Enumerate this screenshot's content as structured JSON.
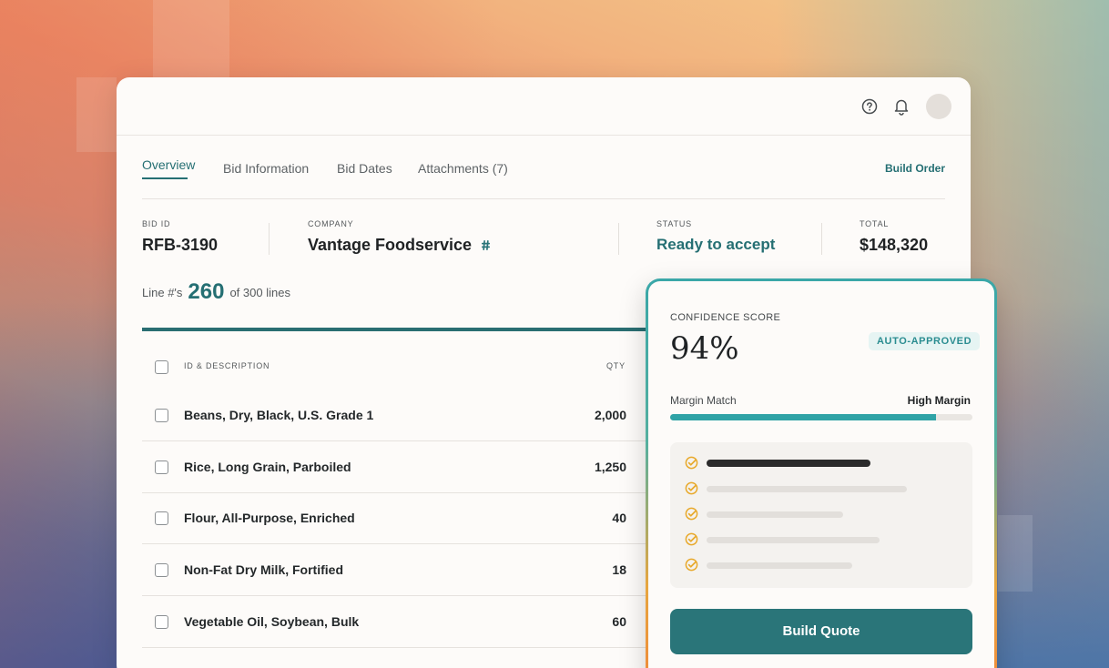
{
  "header": {
    "help_icon": "help-circle-icon",
    "bell_icon": "bell-icon"
  },
  "tabs": [
    {
      "label": "Overview",
      "active": true
    },
    {
      "label": "Bid Information",
      "active": false
    },
    {
      "label": "Bid Dates",
      "active": false
    },
    {
      "label": "Attachments (7)",
      "active": false
    }
  ],
  "build_order_label": "Build Order",
  "meta": {
    "bid_id_label": "BID ID",
    "bid_id": "RFB-3190",
    "company_label": "COMPANY",
    "company": "Vantage Foodservice",
    "status_label": "STATUS",
    "status": "Ready to accept",
    "total_label": "TOTAL",
    "total": "$148,320"
  },
  "lines": {
    "prefix": "Line #'s",
    "count": "260",
    "suffix": "of 300 lines",
    "done": 260,
    "total": 300
  },
  "table": {
    "col_desc": "ID & DESCRIPTION",
    "col_qty": "QTY",
    "rows": [
      {
        "desc": "Beans, Dry, Black, U.S. Grade 1",
        "qty": "2,000"
      },
      {
        "desc": "Rice, Long Grain, Parboiled",
        "qty": "1,250"
      },
      {
        "desc": "Flour, All-Purpose, Enriched",
        "qty": "40"
      },
      {
        "desc": "Non-Fat Dry Milk, Fortified",
        "qty": "18"
      },
      {
        "desc": "Vegetable Oil, Soybean, Bulk",
        "qty": "60"
      }
    ]
  },
  "card": {
    "confidence_label": "CONFIDENCE SCORE",
    "confidence_value": "94%",
    "badge": "AUTO-APPROVED",
    "margin_label": "Margin Match",
    "margin_value": "High Margin",
    "margin_fill": 0.88,
    "build_quote_label": "Build Quote"
  },
  "colors": {
    "accent": "#256f73",
    "teal": "#2fa3a6",
    "check": "#e8a92b"
  }
}
